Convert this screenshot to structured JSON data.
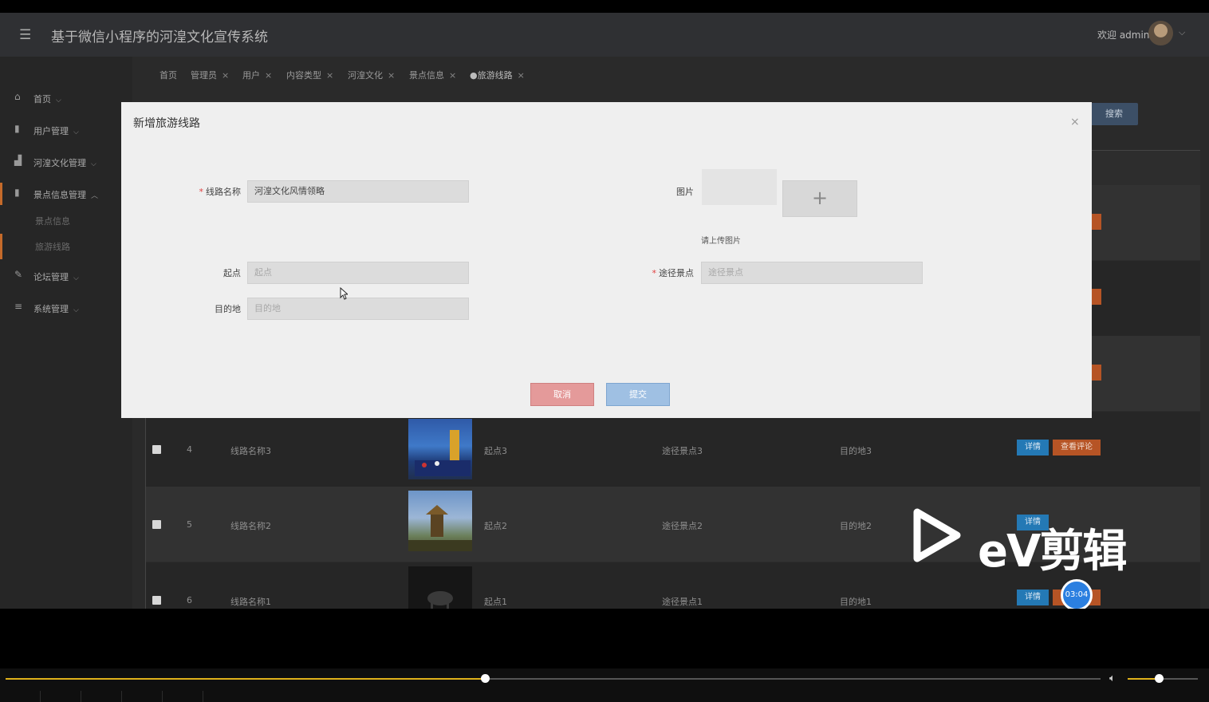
{
  "header": {
    "title": "基于微信小程序的河湟文化宣传系统",
    "welcome": "欢迎 admin"
  },
  "sidebar": {
    "items": [
      {
        "label": "首页",
        "icon": "home-icon"
      },
      {
        "label": "用户管理",
        "icon": "user-book-icon"
      },
      {
        "label": "河湟文化管理",
        "icon": "chart-icon"
      },
      {
        "label": "景点信息管理",
        "icon": "bookmark-icon"
      },
      {
        "label": "论坛管理",
        "icon": "edit-icon"
      },
      {
        "label": "系统管理",
        "icon": "list-icon"
      }
    ],
    "sub_items": [
      "景点信息",
      "旅游线路"
    ]
  },
  "tabs": [
    "首页",
    "管理员",
    "用户",
    "内容类型",
    "河湟文化",
    "景点信息",
    "旅游线路"
  ],
  "search_label": "搜索",
  "table": {
    "rows": [
      {
        "index": "4",
        "name": "线路名称3",
        "start": "起点3",
        "via": "途径景点3",
        "dest": "目的地3"
      },
      {
        "index": "5",
        "name": "线路名称2",
        "start": "起点2",
        "via": "途径景点2",
        "dest": "目的地2"
      },
      {
        "index": "6",
        "name": "线路名称1",
        "start": "起点1",
        "via": "途径景点1",
        "dest": "目的地1"
      }
    ],
    "detail_label": "详情",
    "review_label": "查看评论"
  },
  "modal": {
    "title": "新增旅游线路",
    "close": "×",
    "fields": {
      "name_label": "线路名称",
      "name_value": "河湟文化风情领略",
      "start_label": "起点",
      "start_placeholder": "起点",
      "dest_label": "目的地",
      "dest_placeholder": "目的地",
      "image_label": "图片",
      "upload_tip": "请上传图片",
      "via_label": "途径景点",
      "via_placeholder": "途径景点"
    },
    "cancel_label": "取消",
    "submit_label": "提交"
  },
  "watermark": "eV剪辑",
  "timer": "03:04",
  "player": {
    "progress": 0.438,
    "volume": 0.44,
    "accent": "#e0b21a"
  }
}
